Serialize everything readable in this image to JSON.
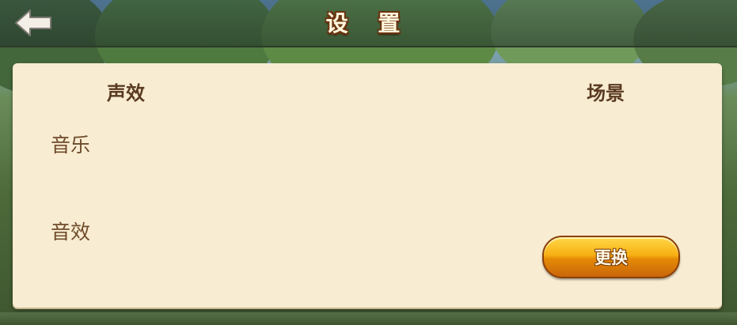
{
  "header": {
    "title": "设 置",
    "back_icon": "back-arrow-icon"
  },
  "panel": {
    "sections": {
      "sound": "声效",
      "scene": "场景"
    },
    "rows": {
      "music": "音乐",
      "sfx": "音效"
    },
    "change_button_label": "更换"
  },
  "colors": {
    "panel_bg": "#f8ecd2",
    "text_brown": "#6e4b2a",
    "button_orange": "#f7b012"
  }
}
